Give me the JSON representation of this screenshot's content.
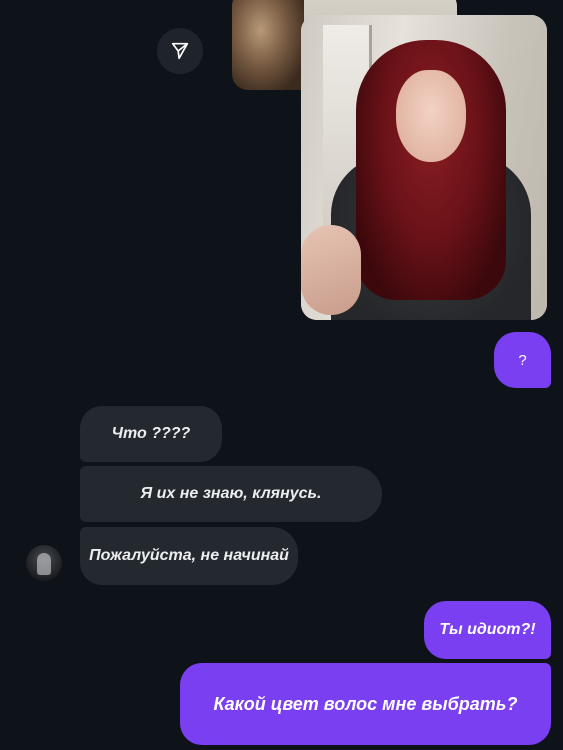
{
  "chat": {
    "messages": [
      {
        "direction": "outgoing",
        "text": "?"
      },
      {
        "direction": "incoming",
        "text": "Что ????"
      },
      {
        "direction": "incoming",
        "text": "Я их не знаю, клянусь."
      },
      {
        "direction": "incoming",
        "text": "Пожалуйста, не начинай"
      },
      {
        "direction": "outgoing",
        "text": "Ты идиот?!"
      },
      {
        "direction": "outgoing",
        "text": "Какой цвет волос мне выбрать?"
      }
    ]
  },
  "icons": {
    "share": "send-icon"
  },
  "colors": {
    "background": "#0e1219",
    "outgoing_bubble": "#7b3ff2",
    "incoming_bubble": "#24282f",
    "text": "#ffffff"
  }
}
